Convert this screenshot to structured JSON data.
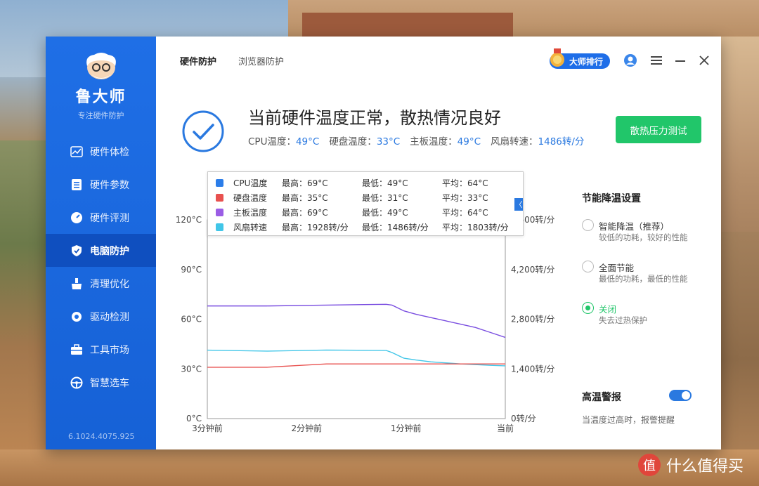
{
  "sidebar": {
    "app_name": "鲁大师",
    "tagline": "专注硬件防护",
    "version": "6.1024.4075.925",
    "items": [
      {
        "label": "硬件体检",
        "icon": "chart-icon"
      },
      {
        "label": "硬件参数",
        "icon": "list-icon"
      },
      {
        "label": "硬件评测",
        "icon": "gauge-icon"
      },
      {
        "label": "电脑防护",
        "icon": "shield-icon"
      },
      {
        "label": "清理优化",
        "icon": "broom-icon"
      },
      {
        "label": "驱动检测",
        "icon": "gear-icon"
      },
      {
        "label": "工具市场",
        "icon": "toolbox-icon"
      },
      {
        "label": "智慧选车",
        "icon": "steering-icon"
      }
    ],
    "active_index": 3
  },
  "tabs": [
    "硬件防护",
    "浏览器防护"
  ],
  "topbar": {
    "rank_label": "大师排行"
  },
  "status": {
    "title": "当前硬件温度正常，散热情况良好",
    "readings": [
      {
        "label": "CPU温度：",
        "value": "49°C"
      },
      {
        "label": "硬盘温度：",
        "value": "33°C"
      },
      {
        "label": "主板温度：",
        "value": "49°C"
      },
      {
        "label": "风扇转速：",
        "value": "1486转/分"
      }
    ]
  },
  "stress_button": "散热压力测试",
  "legend": [
    {
      "name": "CPU温度",
      "max": "最高：69°C",
      "min": "最低：49°C",
      "avg": "平均：64°C",
      "color": "#2b7de9"
    },
    {
      "name": "硬盘温度",
      "max": "最高：35°C",
      "min": "最低：31°C",
      "avg": "平均：33°C",
      "color": "#e8514f"
    },
    {
      "name": "主板温度",
      "max": "最高：69°C",
      "min": "最低：49°C",
      "avg": "平均：64°C",
      "color": "#9b5de5"
    },
    {
      "name": "风扇转速",
      "max": "最高：1928转/分",
      "min": "最低：1486转/分",
      "avg": "平均：1803转/分",
      "color": "#41c6e8"
    }
  ],
  "collapse_glyph": "〈",
  "chart_data": {
    "type": "line",
    "x_ticks": [
      "3分钟前",
      "2分钟前",
      "1分钟前",
      "当前"
    ],
    "y_left_ticks": [
      "0°C",
      "30°C",
      "60°C",
      "90°C",
      "120°C"
    ],
    "y_right_ticks": [
      "0转/分",
      "1,400转/分",
      "2,800转/分",
      "4,200转/分",
      "5,600转/分"
    ],
    "ylim_left": [
      0,
      120
    ],
    "ylim_right": [
      0,
      5600
    ],
    "x": [
      0,
      0.2,
      0.4,
      0.6,
      0.62,
      0.66,
      0.7,
      0.75,
      0.8,
      0.85,
      0.9,
      0.95,
      1.0
    ],
    "series": [
      {
        "name": "主板温度",
        "axis": "left",
        "color": "#7a4ee0",
        "values": [
          68,
          68,
          68.5,
          69,
          68.5,
          65,
          63,
          61,
          59,
          57,
          55,
          52,
          49
        ]
      },
      {
        "name": "风扇转速",
        "axis": "right",
        "color": "#41c6e8",
        "values": [
          1928,
          1900,
          1930,
          1920,
          1860,
          1700,
          1650,
          1600,
          1570,
          1540,
          1520,
          1500,
          1486
        ]
      },
      {
        "name": "硬盘温度",
        "axis": "left",
        "color": "#e8514f",
        "values": [
          31,
          31,
          33,
          33,
          33,
          33,
          33,
          33,
          33,
          33,
          33,
          33,
          33
        ]
      }
    ]
  },
  "settings": {
    "title": "节能降温设置",
    "options": [
      {
        "label": "智能降温（推荐）",
        "desc": "较低的功耗，较好的性能",
        "checked": false
      },
      {
        "label": "全面节能",
        "desc": "最低的功耗，最低的性能",
        "checked": false
      },
      {
        "label": "关闭",
        "desc": "失去过热保护",
        "checked": true
      }
    ],
    "alarm_title": "高温警报",
    "alarm_on": true,
    "alarm_desc": "当温度过高时，报警提醒"
  },
  "watermark": {
    "logo": "值",
    "text": "什么值得买"
  }
}
